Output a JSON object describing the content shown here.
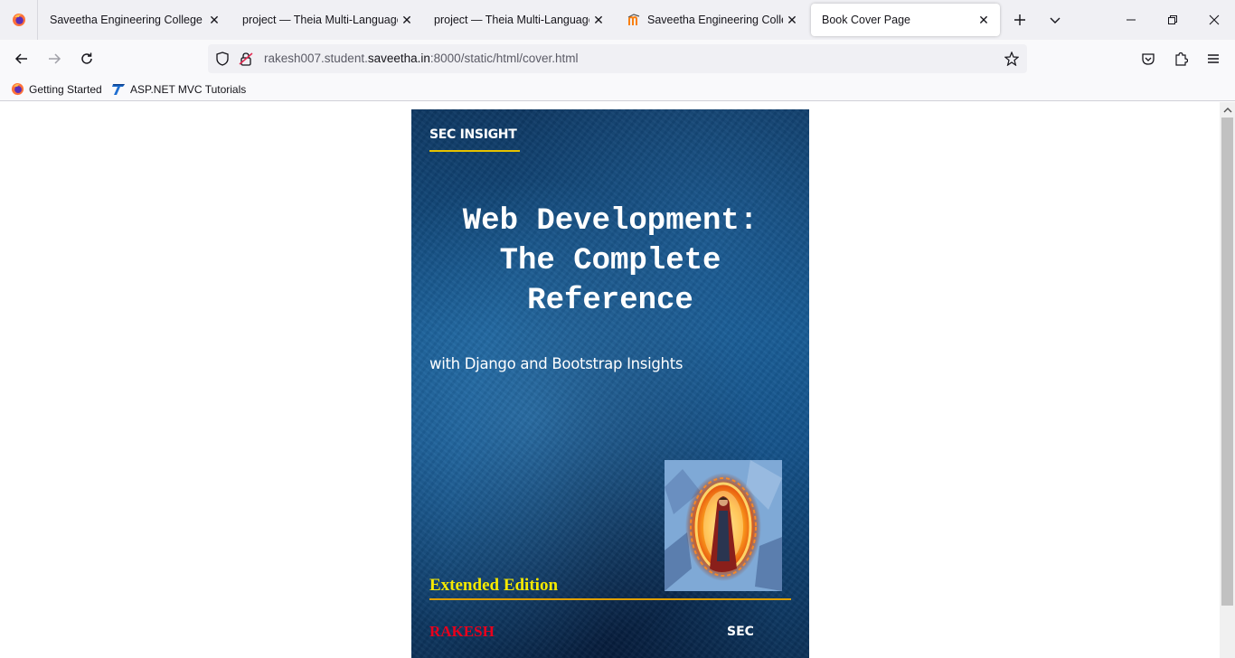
{
  "browser": {
    "tabs": [
      {
        "title": "Saveetha Engineering College",
        "favicon": "none",
        "active": false
      },
      {
        "title": "project — Theia Multi-Language IDE",
        "favicon": "none",
        "active": false
      },
      {
        "title": "project — Theia Multi-Language IDE",
        "favicon": "none",
        "active": false
      },
      {
        "title": "Saveetha Engineering College",
        "favicon": "moodle-icon",
        "active": false
      },
      {
        "title": "Book Cover Page",
        "favicon": "none",
        "active": true
      }
    ],
    "url": {
      "prefix": "rakesh007.student.",
      "host": "saveetha.in",
      "suffix": ":8000/static/html/cover.html"
    },
    "bookmarks": [
      {
        "label": "Getting Started",
        "icon": "firefox-icon"
      },
      {
        "label": "ASP.NET MVC Tutorials",
        "icon": "tutorials-icon"
      }
    ]
  },
  "cover": {
    "publisher": "SEC INSIGHT",
    "title_lines": [
      "Web Development:",
      "The Complete",
      "Reference"
    ],
    "subtitle": "with Django and Bootstrap Insights",
    "edition": "Extended Edition",
    "author": "RAKESH",
    "imprint": "SEC",
    "colors": {
      "background": "#135087",
      "accent_line": "#e6c200",
      "edition": "#f5e900",
      "author": "#e8001c"
    }
  }
}
